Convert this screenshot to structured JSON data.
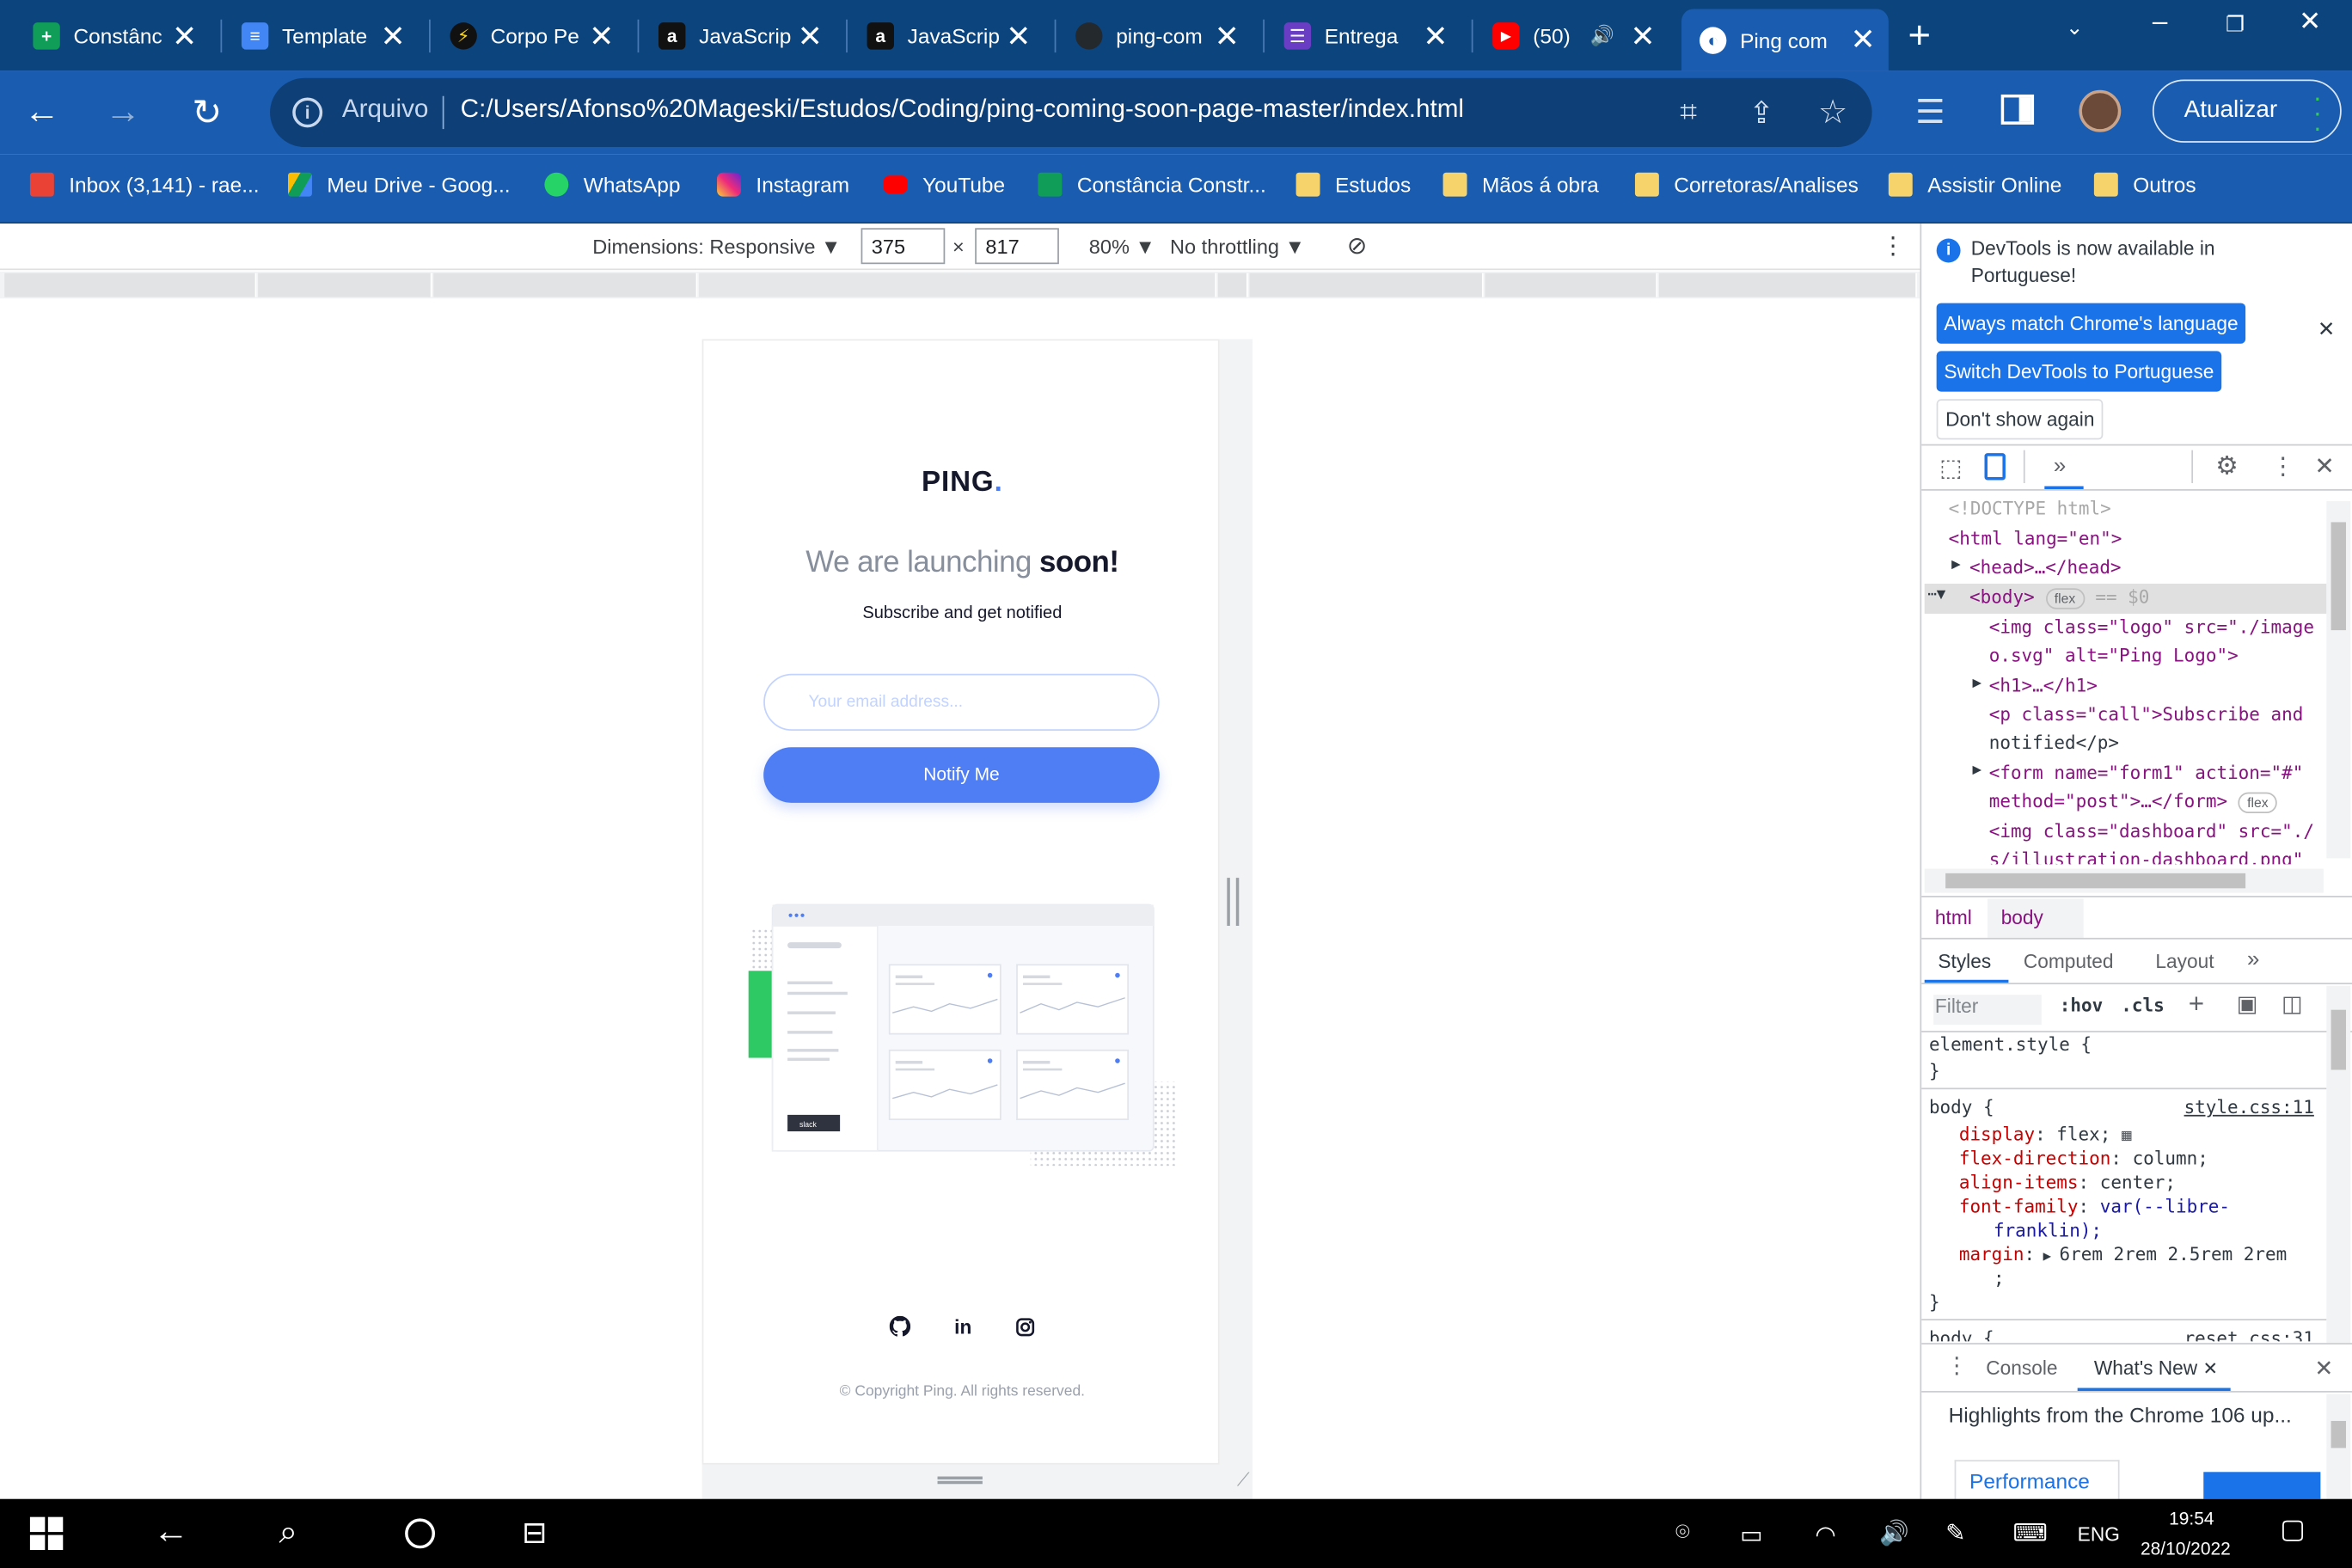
{
  "tabs": [
    {
      "title": "Constânc",
      "favicon": "green-plus-icon",
      "color": "#0f9d58"
    },
    {
      "title": "Template",
      "favicon": "google-docs-icon",
      "color": "#4285f4"
    },
    {
      "title": "Corpo Pe",
      "favicon": "bolt-icon",
      "color": "#111111"
    },
    {
      "title": "JavaScrip",
      "favicon": "letter-a-icon",
      "color": "#111111"
    },
    {
      "title": "JavaScrip",
      "favicon": "letter-a-icon",
      "color": "#111111"
    },
    {
      "title": "ping-com",
      "favicon": "github-icon",
      "color": "#24292e"
    },
    {
      "title": "Entrega",
      "favicon": "list-icon",
      "color": "#6a3ec4"
    },
    {
      "title": "(50)",
      "favicon": "youtube-icon",
      "color": "#ff0000"
    },
    {
      "title": "Ping com",
      "favicon": "globe-icon",
      "color": "#ffffff"
    }
  ],
  "toolbar": {
    "scheme": "Arquivo",
    "url": "C:/Users/Afonso%20Mageski/Estudos/Coding/ping-coming-soon-page-master/index.html",
    "update_label": "Atualizar"
  },
  "bookmarks": [
    {
      "label": "Inbox (3,141) - rae...",
      "icon": "gmail-icon",
      "color": "#ea4335"
    },
    {
      "label": "Meu Drive - Goog...",
      "icon": "drive-icon",
      "color": "#fbbc04"
    },
    {
      "label": "WhatsApp",
      "icon": "whatsapp-icon",
      "color": "#25d366"
    },
    {
      "label": "Instagram",
      "icon": "instagram-icon",
      "color": "#e1306c"
    },
    {
      "label": "YouTube",
      "icon": "youtube-icon",
      "color": "#ff0000"
    },
    {
      "label": "Constância Constr...",
      "icon": "green-plus-icon",
      "color": "#0f9d58"
    },
    {
      "label": "Estudos",
      "icon": "folder-icon",
      "color": "#f6d36b"
    },
    {
      "label": "Mãos á obra",
      "icon": "folder-icon",
      "color": "#f6d36b"
    },
    {
      "label": "Corretoras/Analises",
      "icon": "folder-icon",
      "color": "#f6d36b"
    },
    {
      "label": "Assistir Online",
      "icon": "folder-icon",
      "color": "#f6d36b"
    },
    {
      "label": "Outros",
      "icon": "folder-icon",
      "color": "#f6d36b"
    }
  ],
  "device_toolbar": {
    "dimensions_label": "Dimensions: Responsive",
    "width": "375",
    "height": "817",
    "times": "×",
    "zoom": "80%",
    "throttling": "No throttling"
  },
  "page": {
    "logo": "PING",
    "logo_dot": ".",
    "headline_light": "We are launching",
    "headline_bold": "soon!",
    "subtitle": "Subscribe and get notified",
    "email_placeholder": "Your email address...",
    "notify_label": "Notify Me",
    "dashboard_badge": "slack",
    "copyright": "© Copyright Ping. All rights reserved.",
    "accent": "#4f7df3"
  },
  "devtools": {
    "banner_text_1": "DevTools is now available in",
    "banner_text_2": "Portuguese!",
    "btn_match": "Always match Chrome's language",
    "btn_switch": "Switch DevTools to Portuguese",
    "btn_dont": "Don't show again",
    "dom": {
      "doctype": "<!DOCTYPE html>",
      "html_open": "<html lang=\"en\">",
      "head": "<head>…</head>",
      "body": "<body>",
      "body_badge": "flex",
      "body_eq": "== $0",
      "img1a": "<img class=\"logo\" src=\"./image",
      "img1b": "o.svg\" alt=\"Ping Logo\">",
      "h1": "<h1>…</h1>",
      "p1a": "<p class=\"call\">Subscribe and",
      "p1b": "notified</p>",
      "form1a": "<form name=\"form1\" action=\"#\"",
      "form1b": "method=\"post\">…</form>",
      "form_badge": "flex",
      "img2a": "<img class=\"dashboard\" src=\"./",
      "img2b": "s/illustration-dashboard.png\""
    },
    "breadcrumbs": [
      "html",
      "body"
    ],
    "tabs": [
      "Styles",
      "Computed",
      "Layout"
    ],
    "filter_placeholder": "Filter",
    "hov": ":hov",
    "cls": ".cls",
    "styles": {
      "element_style": "element.style {",
      "close": "}",
      "body_selector": "body {",
      "source": "style.css:11",
      "rules": [
        {
          "prop": "display",
          "value": "flex;"
        },
        {
          "prop": "flex-direction",
          "value": "column;"
        },
        {
          "prop": "align-items",
          "value": "center;"
        },
        {
          "prop": "font-family",
          "value": "var(--libre-"
        },
        {
          "prop": "",
          "value": "franklin);"
        },
        {
          "prop": "margin",
          "value": "6rem 2rem 2.5rem 2rem"
        },
        {
          "prop": "",
          "value": ";"
        }
      ],
      "next_selector": "body {",
      "next_source": "reset.css:31"
    },
    "drawer_tabs": [
      "Console",
      "What's New"
    ],
    "whats_new_text": "Highlights from the Chrome 106 up...",
    "perf_label": "Performance"
  },
  "taskbar": {
    "time": "19:54",
    "date": "28/10/2022",
    "lang": "ENG"
  }
}
